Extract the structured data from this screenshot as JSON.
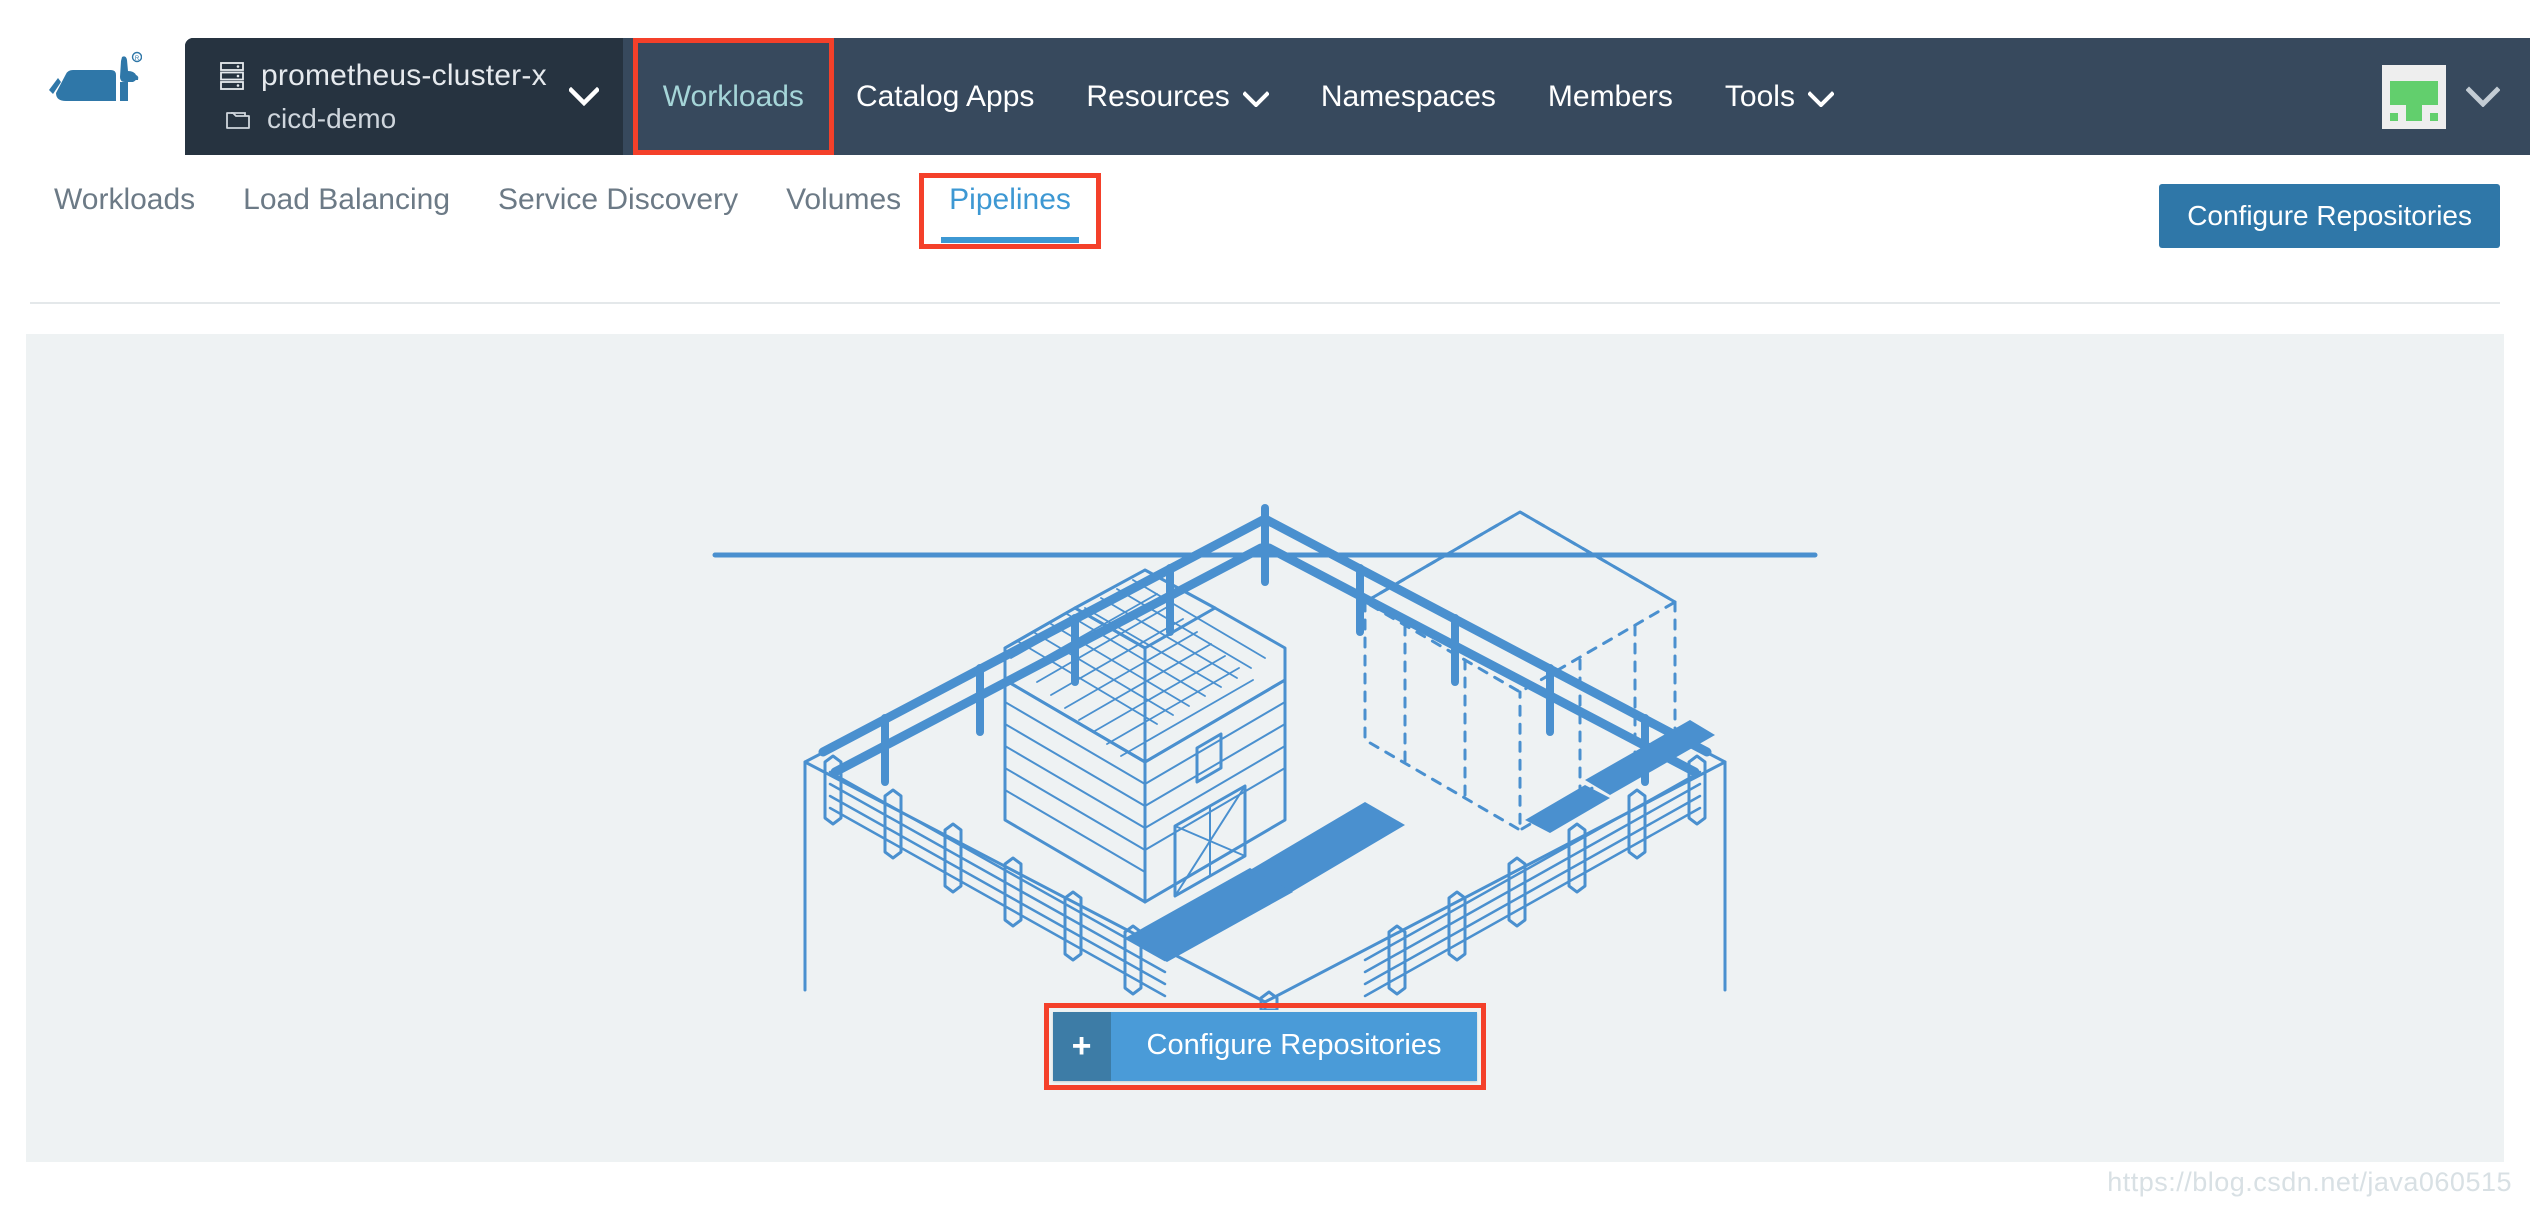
{
  "brand": {
    "logo_icon": "rancher-cow-logo",
    "logo_color": "#2f77a8"
  },
  "header": {
    "background_color": "#37495d",
    "cluster_selector": {
      "cluster_icon": "server-stack-icon",
      "cluster_name": "prometheus-cluster-x",
      "project_icon": "folder-icon",
      "project_name": "cicd-demo",
      "caret_icon": "chevron-down-icon",
      "background_color": "#263340"
    },
    "nav_items": [
      {
        "label": "Workloads",
        "active": true,
        "has_caret": false
      },
      {
        "label": "Catalog Apps",
        "active": false,
        "has_caret": false
      },
      {
        "label": "Resources",
        "active": false,
        "has_caret": true
      },
      {
        "label": "Namespaces",
        "active": false,
        "has_caret": false
      },
      {
        "label": "Members",
        "active": false,
        "has_caret": false
      },
      {
        "label": "Tools",
        "active": false,
        "has_caret": true
      }
    ],
    "active_color": "#a5d5d8",
    "user": {
      "avatar_icon": "identicon-avatar",
      "avatar_color": "#62cf6d",
      "caret_icon": "chevron-down-icon"
    }
  },
  "subnav": {
    "tabs": [
      {
        "label": "Workloads",
        "active": false
      },
      {
        "label": "Load Balancing",
        "active": false
      },
      {
        "label": "Service Discovery",
        "active": false
      },
      {
        "label": "Volumes",
        "active": false
      },
      {
        "label": "Pipelines",
        "active": true
      }
    ],
    "active_color": "#3d98d3",
    "action_button": {
      "label": "Configure Repositories",
      "color": "#2f77a8"
    }
  },
  "main": {
    "background_color": "#eef2f3",
    "illustration": "isometric-barn-fence-empty-state",
    "illustration_color": "#4a90cf",
    "cta": {
      "plus_icon": "plus-icon",
      "label": "Configure Repositories",
      "plus_color": "#3d7ca6",
      "label_color": "#4a9bd8"
    }
  },
  "annotations": {
    "color": "#f4402a",
    "boxes": [
      {
        "name": "workloads-nav-highlight"
      },
      {
        "name": "pipelines-tab-highlight"
      },
      {
        "name": "configure-repositories-cta-highlight"
      }
    ]
  },
  "watermark": {
    "text": "https://blog.csdn.net/java060515"
  }
}
